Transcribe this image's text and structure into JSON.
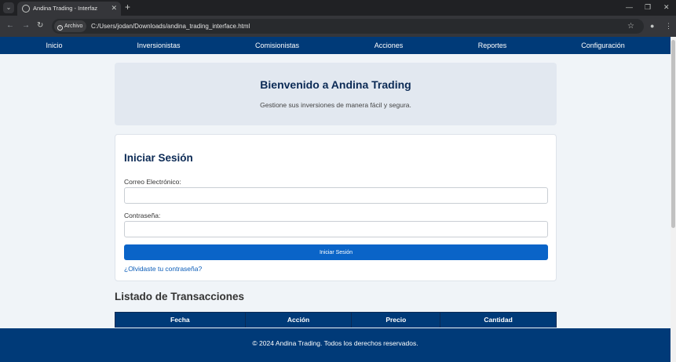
{
  "browser": {
    "tab_title": "Andina Trading - Interfaz",
    "site_chip": "Archivo",
    "url": "C:/Users/jodan/Downloads/andina_trading_interface.html"
  },
  "nav": {
    "items": [
      {
        "label": "Inicio"
      },
      {
        "label": "Inversionistas"
      },
      {
        "label": "Comisionistas"
      },
      {
        "label": "Acciones"
      },
      {
        "label": "Reportes"
      },
      {
        "label": "Configuración"
      }
    ]
  },
  "welcome": {
    "title": "Bienvenido a Andina Trading",
    "subtitle": "Gestione sus inversiones de manera fácil y segura."
  },
  "login": {
    "title": "Iniciar Sesión",
    "email_label": "Correo Electrónico:",
    "email_value": "",
    "password_label": "Contraseña:",
    "password_value": "",
    "submit_label": "Iniciar Sesión",
    "forgot_link": "¿Olvidaste tu contraseña?"
  },
  "transactions": {
    "title": "Listado de Transacciones",
    "columns": [
      "Fecha",
      "Acción",
      "Precio",
      "Cantidad"
    ]
  },
  "footer": {
    "text": "© 2024 Andina Trading. Todos los derechos reservados."
  }
}
